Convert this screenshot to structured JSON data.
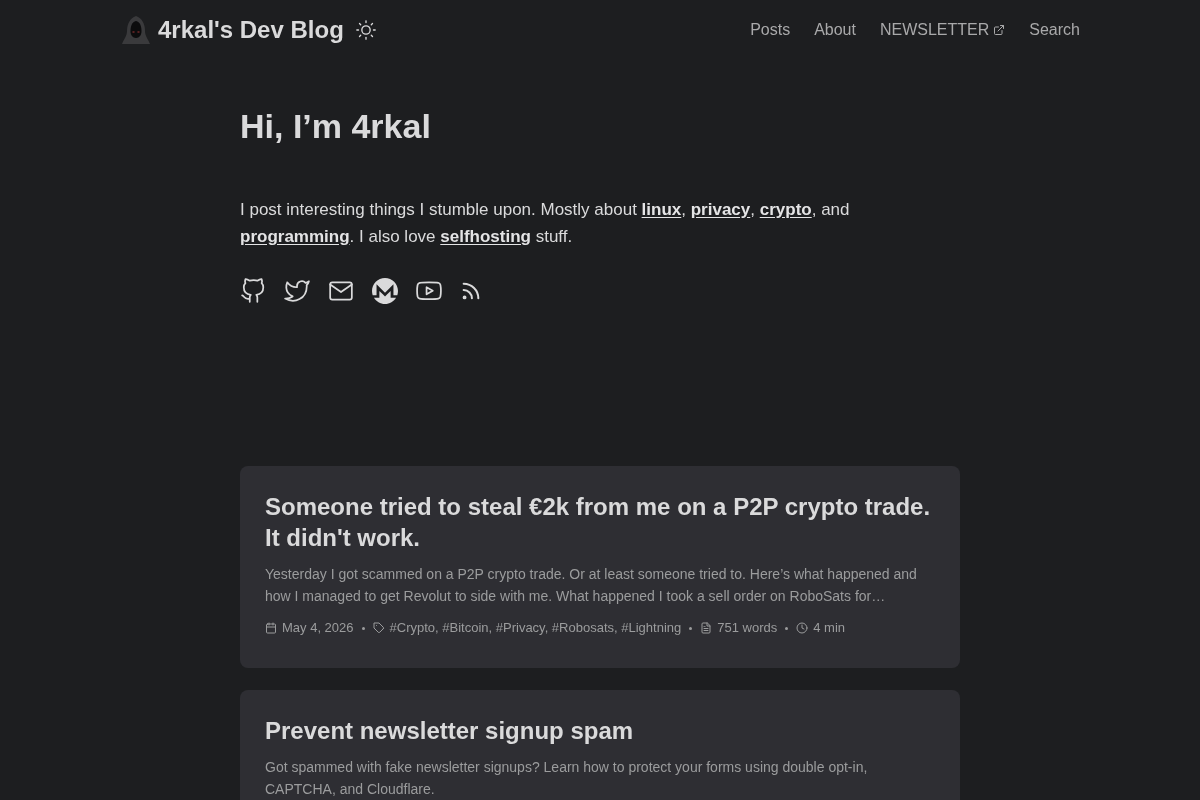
{
  "header": {
    "title": "4rkal's Dev Blog",
    "nav": [
      {
        "label": "Posts",
        "external": false
      },
      {
        "label": "About",
        "external": false
      },
      {
        "label": "NEWSLETTER",
        "external": true
      },
      {
        "label": "Search",
        "external": false
      }
    ]
  },
  "intro": {
    "heading": "Hi, I’m 4rkal",
    "bio": [
      {
        "kind": "text",
        "text": "I post interesting things I stumble upon. Mostly about "
      },
      {
        "kind": "link",
        "text": "linux"
      },
      {
        "kind": "text",
        "text": ", "
      },
      {
        "kind": "link",
        "text": "privacy"
      },
      {
        "kind": "text",
        "text": ", "
      },
      {
        "kind": "link",
        "text": "crypto"
      },
      {
        "kind": "text",
        "text": ", and "
      },
      {
        "kind": "link",
        "text": "programming"
      },
      {
        "kind": "text",
        "text": ". I also love "
      },
      {
        "kind": "link",
        "text": "selfhosting"
      },
      {
        "kind": "text",
        "text": " stuff."
      }
    ],
    "socials": [
      {
        "kind": "github"
      },
      {
        "kind": "twitter"
      },
      {
        "kind": "mail"
      },
      {
        "kind": "monero"
      },
      {
        "kind": "youtube"
      },
      {
        "kind": "rss"
      }
    ]
  },
  "posts": [
    {
      "title": "Someone tried to steal €2k from me on a P2P crypto trade. It didn't work.",
      "description": "Yesterday I got scammed on a P2P crypto trade. Or at least someone tried to. Here’s what happened and how I managed to get Revolut to side with me. What happened I took a sell order on RoboSats for…",
      "date": "May 4, 2026",
      "tags": "#Crypto, #Bitcoin, #Privacy, #Robosats, #Lightning",
      "words": "751 words",
      "reading_time": "4 min"
    },
    {
      "title": "Prevent newsletter signup spam",
      "description": "Got spammed with fake newsletter signups? Learn how to protect your forms using double opt-in, CAPTCHA, and Cloudflare."
    }
  ]
}
